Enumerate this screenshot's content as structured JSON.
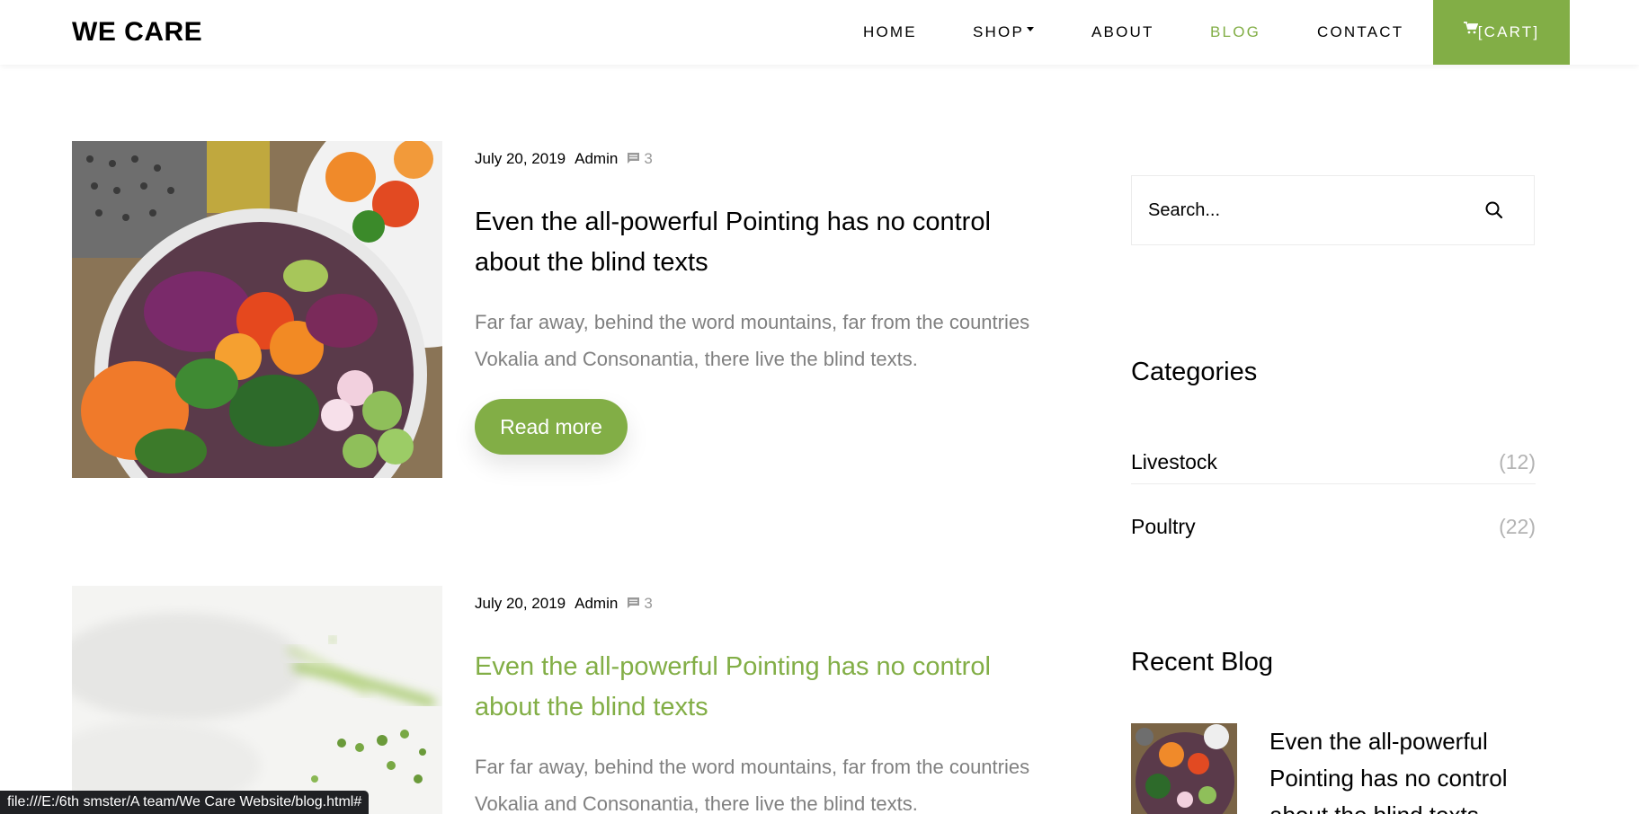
{
  "brand": "WE CARE",
  "nav": {
    "home": "HOME",
    "shop": "SHOP",
    "about": "ABOUT",
    "blog": "BLOG",
    "contact": "CONTACT",
    "cart": "[CART]"
  },
  "posts": [
    {
      "date": "July 20, 2019",
      "author": "Admin",
      "comments": "3",
      "title": "Even the all-powerful Pointing has no control about the blind texts",
      "excerpt": "Far far away, behind the word mountains, far from the countries Vokalia and Consonantia, there live the blind texts.",
      "read_more": "Read more"
    },
    {
      "date": "July 20, 2019",
      "author": "Admin",
      "comments": "3",
      "title": "Even the all-powerful Pointing has no control about the blind texts",
      "excerpt": "Far far away, behind the word mountains, far from the countries Vokalia and Consonantia, there live the blind texts."
    }
  ],
  "sidebar": {
    "search_placeholder": "Search...",
    "categories_heading": "Categories",
    "categories": [
      {
        "label": "Livestock",
        "count": "(12)"
      },
      {
        "label": "Poultry",
        "count": "(22)"
      }
    ],
    "recent_heading": "Recent Blog",
    "recent": [
      {
        "title": "Even the all-powerful Pointing has no control about the blind texts"
      }
    ]
  },
  "statusbar": "file:///E:/6th smster/A team/We Care Website/blog.html#",
  "colors": {
    "accent": "#82ae46",
    "muted_text": "#808080",
    "count_text": "#b3b3b3"
  },
  "icons": {
    "cart": "cart-icon",
    "comment": "comment-icon",
    "search": "search-icon"
  }
}
